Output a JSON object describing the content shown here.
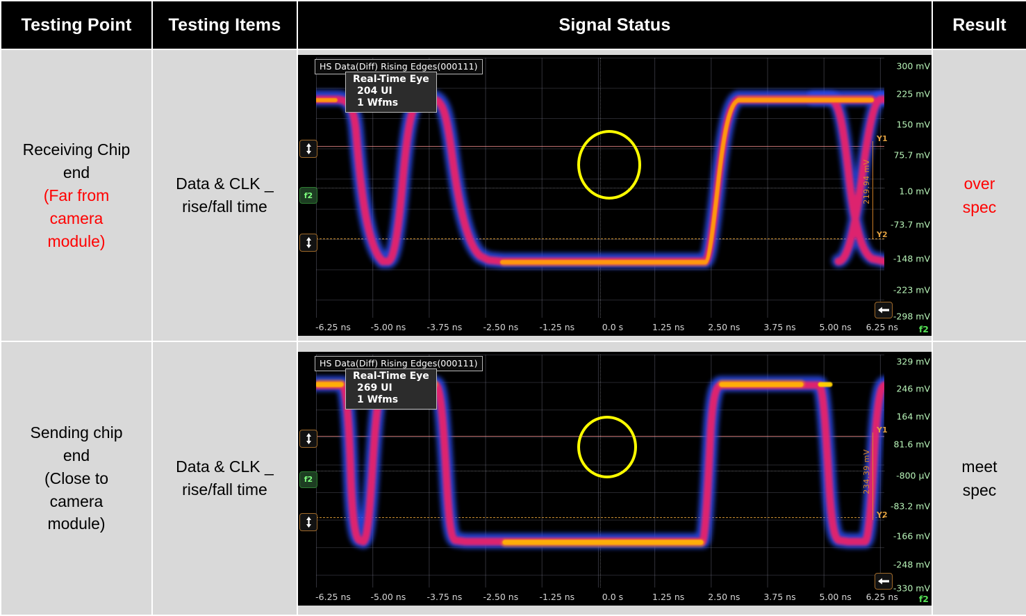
{
  "table": {
    "headers": [
      {
        "id": "testing-point",
        "label": "Testing Point"
      },
      {
        "id": "testing-items",
        "label": "Testing Items"
      },
      {
        "id": "signal-status",
        "label": "Signal Status"
      },
      {
        "id": "result",
        "label": "Result"
      }
    ],
    "rows": [
      {
        "id": "row-receiving-chip",
        "testing_point": {
          "line1": "Receiving Chip",
          "line2": "end",
          "line3": "(Far from",
          "line4": "camera",
          "line5": "module)",
          "black_lines": 2,
          "red_color": "#ff0000"
        },
        "testing_items": {
          "line1": "Data & CLK _",
          "line2": "rise/fall time"
        },
        "result": {
          "line1": "over",
          "line2": "spec",
          "color": "#ff0000"
        }
      },
      {
        "id": "row-sending-chip",
        "testing_point": {
          "line1": "Sending chip",
          "line2": "end",
          "line3": "(Close to",
          "line4": "camera",
          "line5": "module)",
          "black_lines": 5,
          "red_color": "#000000"
        },
        "testing_items": {
          "line1": "Data & CLK _",
          "line2": "rise/fall time"
        },
        "result": {
          "line1": "meet",
          "line2": "spec",
          "color": "#000000"
        }
      }
    ]
  },
  "chart_data": [
    {
      "id": "scope-receiving-chip",
      "type": "line",
      "title": "HS Data(Diff) Rising Edges(000111)",
      "overlay": {
        "title": "Real-Time Eye",
        "ui": "204 UI",
        "wfms": "1 Wfms"
      },
      "xlabel": "",
      "ylabel": "",
      "xlim": [
        -6.25,
        6.25
      ],
      "ylim": [
        -298,
        300
      ],
      "x_ticks": [
        "-6.25 ns",
        "-5.00 ns",
        "-3.75 ns",
        "-2.50 ns",
        "-1.25 ns",
        "0.0 s",
        "1.25 ns",
        "2.50 ns",
        "3.75 ns",
        "5.00 ns",
        "6.25 ns"
      ],
      "x_tick_values": [
        -6.25,
        -5.0,
        -3.75,
        -2.5,
        -1.25,
        0.0,
        1.25,
        2.5,
        3.75,
        5.0,
        6.25
      ],
      "y_ticks": [
        "300 mV",
        "225 mV",
        "150 mV",
        "75.7 mV",
        "1.0 mV",
        "-73.7 mV",
        "-148 mV",
        "-223 mV",
        "-298 mV"
      ],
      "y_tick_values": [
        300,
        225,
        150,
        75.7,
        1.0,
        -73.7,
        -148,
        -223,
        -298
      ],
      "cursors": {
        "y1_label": "Y1",
        "y2_label": "Y2",
        "y1_value": 110,
        "y2_value": -110,
        "delta": "219.94 mV"
      },
      "channel_badge": "f2",
      "corner_label": "f2",
      "grid": true,
      "legend": "none",
      "annotation": "yellow-circle-slow-rising-edge",
      "waveform": {
        "high_level": 160,
        "low_level": -190,
        "edge_speed": "slow",
        "noise": "high",
        "colors": {
          "outer": "#2b4ef0",
          "mid": "#e8216b",
          "core": "#ff9a10"
        }
      }
    },
    {
      "id": "scope-sending-chip",
      "type": "line",
      "title": "HS Data(Diff) Rising Edges(000111)",
      "overlay": {
        "title": "Real-Time Eye",
        "ui": "269 UI",
        "wfms": "1 Wfms"
      },
      "xlabel": "",
      "ylabel": "",
      "xlim": [
        -6.25,
        6.25
      ],
      "ylim": [
        -330,
        329
      ],
      "x_ticks": [
        "-6.25 ns",
        "-5.00 ns",
        "-3.75 ns",
        "-2.50 ns",
        "-1.25 ns",
        "0.0 s",
        "1.25 ns",
        "2.50 ns",
        "3.75 ns",
        "5.00 ns",
        "6.25 ns"
      ],
      "x_tick_values": [
        -6.25,
        -5.0,
        -3.75,
        -2.5,
        -1.25,
        0.0,
        1.25,
        2.5,
        3.75,
        5.0,
        6.25
      ],
      "y_ticks": [
        "329 mV",
        "246 mV",
        "164 mV",
        "81.6 mV",
        "-800 µV",
        "-83.2 mV",
        "-166 mV",
        "-248 mV",
        "-330 mV"
      ],
      "y_tick_values": [
        329,
        246,
        164,
        81.6,
        -0.8,
        -83.2,
        -166,
        -248,
        -330
      ],
      "cursors": {
        "y1_label": "Y1",
        "y2_label": "Y2",
        "y1_value": 117,
        "y2_value": -117,
        "delta": "234.39 mV"
      },
      "channel_badge": "f2",
      "corner_label": "f2",
      "grid": true,
      "legend": "none",
      "annotation": "yellow-circle-fast-rising-edge",
      "waveform": {
        "high_level": 200,
        "low_level": -220,
        "edge_speed": "fast",
        "noise": "moderate",
        "colors": {
          "outer": "#2b4ef0",
          "mid": "#e8216b",
          "core": "#ffd000"
        }
      }
    }
  ]
}
